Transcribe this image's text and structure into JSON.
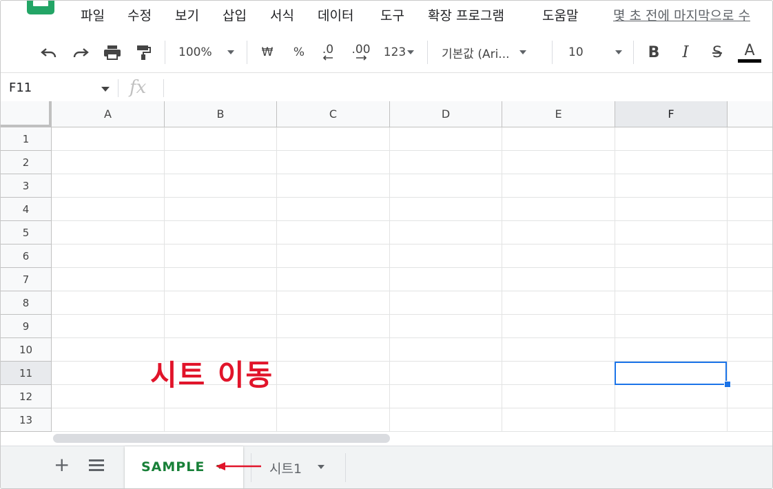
{
  "menu": [
    "파일",
    "수정",
    "보기",
    "삽입",
    "서식",
    "데이터",
    "도구",
    "확장 프로그램",
    "도움말"
  ],
  "last_edit": "몇 초 전에 마지막으로 수",
  "toolbar": {
    "zoom": "100%",
    "currency": "₩",
    "percent": "%",
    "decrease_decimal": ".0",
    "increase_decimal": ".00",
    "number_format": "123",
    "font": "기본값 (Ari...",
    "font_size": "10",
    "bold": "B",
    "italic": "I",
    "strike": "S",
    "text_color": "A"
  },
  "formula_bar": {
    "cell_ref": "F11",
    "fx": "fx",
    "value": ""
  },
  "columns": [
    "A",
    "B",
    "C",
    "D",
    "E",
    "F"
  ],
  "rows": [
    "1",
    "2",
    "3",
    "4",
    "5",
    "6",
    "7",
    "8",
    "9",
    "10",
    "11",
    "12",
    "13"
  ],
  "selected": {
    "column": "F",
    "row": "11"
  },
  "overlay_text": "시트 이동",
  "sheets": [
    {
      "name": "SAMPLE",
      "active": true
    },
    {
      "name": "시트1",
      "active": false
    }
  ],
  "colors": {
    "accent": "#1a73e8",
    "active_tab": "#188038",
    "annotation": "#e1142a"
  }
}
